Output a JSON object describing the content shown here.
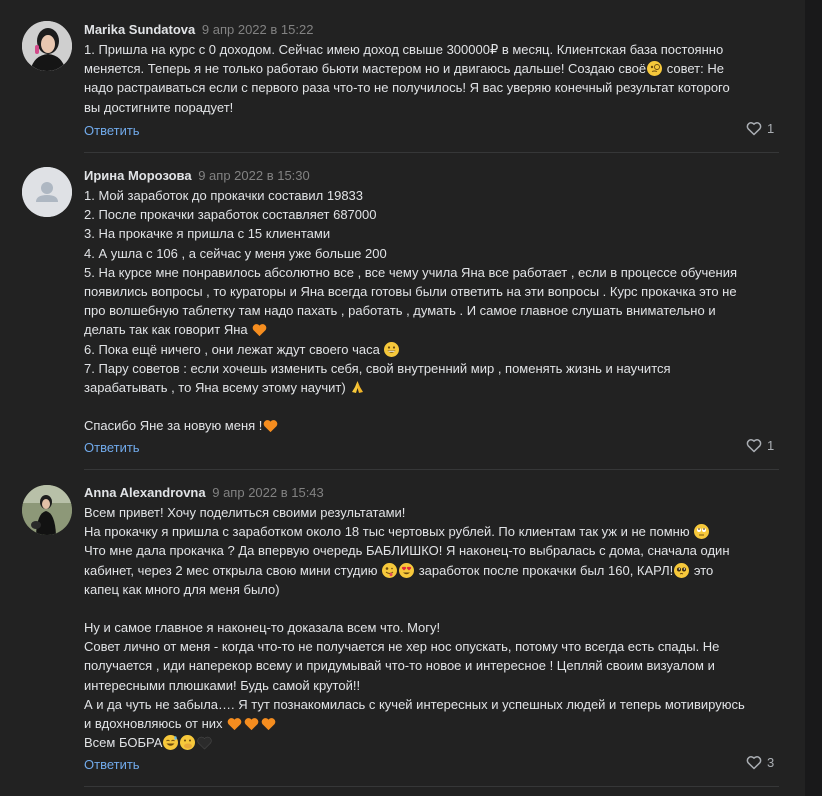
{
  "colors": {
    "background": "#222222",
    "author": "#e1e3e6",
    "date": "#828282",
    "link": "#71aaeb",
    "divider": "#363738"
  },
  "comments": [
    {
      "author": "Marika Sundatova",
      "date": "9 апр 2022 в 15:22",
      "avatar": "photo-avatar",
      "lines": [
        "1. Пришла на курс с 0 доходом. Сейчас имею доход свыше 300000₽ в месяц. Клиентская база постоянно",
        "меняется. Теперь я не только работаю бьюти мастером но и двигаюсь дальше! Создаю своё",
        " совет: Не",
        "надо растраиваться если с первого раза что-то не получилось! Я вас уверяю конечный результат которого",
        "вы достигните порадует!"
      ],
      "reply_label": "Ответить",
      "likes": "1"
    },
    {
      "author": "Ирина Морозова",
      "date": "9 апр 2022 в 15:30",
      "avatar": "default-avatar",
      "lines": [
        "1. Мой заработок до прокачки составил 19833",
        "2. После прокачки заработок составляет 687000",
        "3. На прокачке я пришла с 15 клиентами",
        "4. А ушла с 106 , а сейчас у меня уже больше 200",
        "5. На курсе мне понравилось абсолютно все , все чему учила Яна все работает , если в процессе обучения",
        "появились вопросы , то кураторы и Яна всегда готовы были ответить на эти вопросы . Курс прокачка это не",
        "про волшебную таблетку там надо пахать , работать , думать . И самое главное слушать внимательно и",
        "делать так как говорит Яна",
        "6. Пока ещё ничего , они лежат ждут своего часа",
        "7. Пару советов : если хочешь изменить себя, свой внутренний мир , поменять жизнь и научится",
        "зарабатывать , то Яна всему этому научит)",
        "",
        "Спасибо Яне за новую меня !"
      ],
      "reply_label": "Ответить",
      "likes": "1"
    },
    {
      "author": "Anna Alexandrovna",
      "date": "9 апр 2022 в 15:43",
      "avatar": "photo-avatar",
      "lines": [
        "Всем привет! Хочу поделиться своими результатами!",
        "На прокачку я пришла с заработком около 18 тыс чертовых рублей. По клиентам так уж и не помню",
        "Что мне дала прокачка ? Да впервую очередь БАБЛИШКО! Я наконец-то выбралась с дома, сначала один",
        "кабинет, через 2 мес открыла свою мини студию",
        " заработок после прокачки был 160, КАРЛ!",
        " это",
        "капец как много для меня было)",
        "",
        "Ну и самое главное я наконец-то доказала всем что. Могу!",
        "Совет лично от меня - когда что-то не получается не хер нос опускать, потому что всегда есть спады. Не",
        "получается , иди наперекор всему и придумывай что-то новое и интересное ! Цепляй своим визуалом и",
        "интересными плюшками! Будь самой крутой!!",
        "А и да чуть не забыла…. Я тут познакомилась с кучей интересных и успешных людей и теперь мотивируюсь",
        "и вдохновляюсь от них",
        "Всем БОБРА"
      ],
      "reply_label": "Ответить",
      "likes": "3"
    }
  ]
}
